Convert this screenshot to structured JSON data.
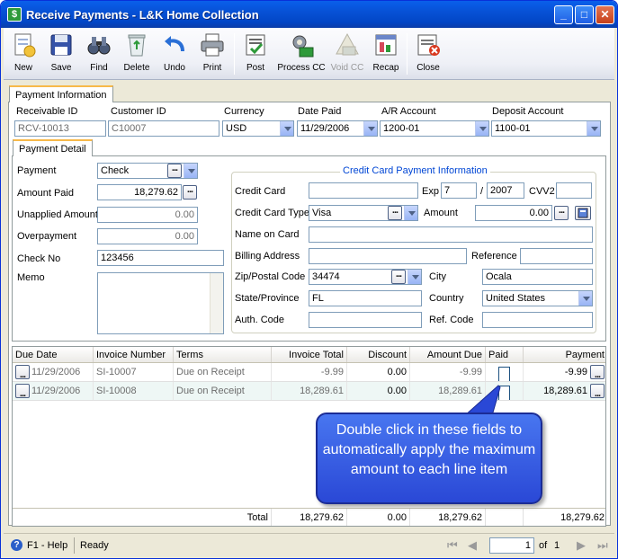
{
  "window": {
    "title": "Receive Payments - L&K Home Collection"
  },
  "toolbar": {
    "new": "New",
    "save": "Save",
    "find": "Find",
    "delete": "Delete",
    "undo": "Undo",
    "print": "Print",
    "post": "Post",
    "process_cc": "Process CC",
    "void_cc": "Void CC",
    "recap": "Recap",
    "close": "Close"
  },
  "tabs": {
    "payment_information": "Payment Information",
    "payment_detail": "Payment Detail"
  },
  "header": {
    "receivable_id_label": "Receivable ID",
    "receivable_id": "RCV-10013",
    "customer_id_label": "Customer ID",
    "customer_id": "C10007",
    "currency_label": "Currency",
    "currency": "USD",
    "date_paid_label": "Date Paid",
    "date_paid": "11/29/2006",
    "ar_account_label": "A/R Account",
    "ar_account": "1200-01",
    "deposit_account_label": "Deposit Account",
    "deposit_account": "1100-01"
  },
  "detail": {
    "payment_label": "Payment",
    "payment": "Check",
    "amount_paid_label": "Amount Paid",
    "amount_paid": "18,279.62",
    "unapplied_label": "Unapplied Amount",
    "unapplied": "0.00",
    "overpayment_label": "Overpayment",
    "overpayment": "0.00",
    "check_no_label": "Check No",
    "check_no": "123456",
    "memo_label": "Memo",
    "memo": ""
  },
  "credit_card": {
    "legend": "Credit Card Payment Information",
    "card_label": "Credit Card",
    "card": "",
    "exp_label": "Exp",
    "exp_month": "7",
    "exp_sep": "/",
    "exp_year": "2007",
    "cvv2_label": "CVV2",
    "cvv2": "",
    "card_type_label": "Credit Card Type",
    "card_type": "Visa",
    "amount_label": "Amount",
    "amount": "0.00",
    "name_label": "Name on Card",
    "name": "",
    "billing_label": "Billing Address",
    "billing": "",
    "reference_label": "Reference",
    "reference": "",
    "zip_label": "Zip/Postal Code",
    "zip": "34474",
    "city_label": "City",
    "city": "Ocala",
    "state_label": "State/Province",
    "state": "FL",
    "country_label": "Country",
    "country": "United States",
    "auth_label": "Auth. Code",
    "auth": "",
    "ref_code_label": "Ref. Code",
    "ref_code": ""
  },
  "grid": {
    "columns": [
      "Due Date",
      "Invoice Number",
      "Terms",
      "Invoice Total",
      "Discount",
      "Amount Due",
      "Paid",
      "Payment"
    ],
    "rows": [
      {
        "due_date": "11/29/2006",
        "invoice": "SI-10007",
        "terms": "Due on Receipt",
        "total": "-9.99",
        "discount": "0.00",
        "amount_due": "-9.99",
        "payment": "-9.99"
      },
      {
        "due_date": "11/29/2006",
        "invoice": "SI-10008",
        "terms": "Due on Receipt",
        "total": "18,289.61",
        "discount": "0.00",
        "amount_due": "18,289.61",
        "payment": "18,289.61"
      }
    ],
    "total_label": "Total",
    "total_invoice": "18,279.62",
    "total_discount": "0.00",
    "total_due": "18,279.62",
    "total_payment": "18,279.62"
  },
  "callout": {
    "text": "Double click in these fields to automatically apply the maximum amount to each line item"
  },
  "status": {
    "help": "F1 - Help",
    "state": "Ready",
    "page": "1",
    "of_label": "of",
    "page_count": "1"
  },
  "colors": {
    "title_bar": "#0A5FEB",
    "callout": "#3A5EE6",
    "tab_accent": "#F7B94A"
  }
}
